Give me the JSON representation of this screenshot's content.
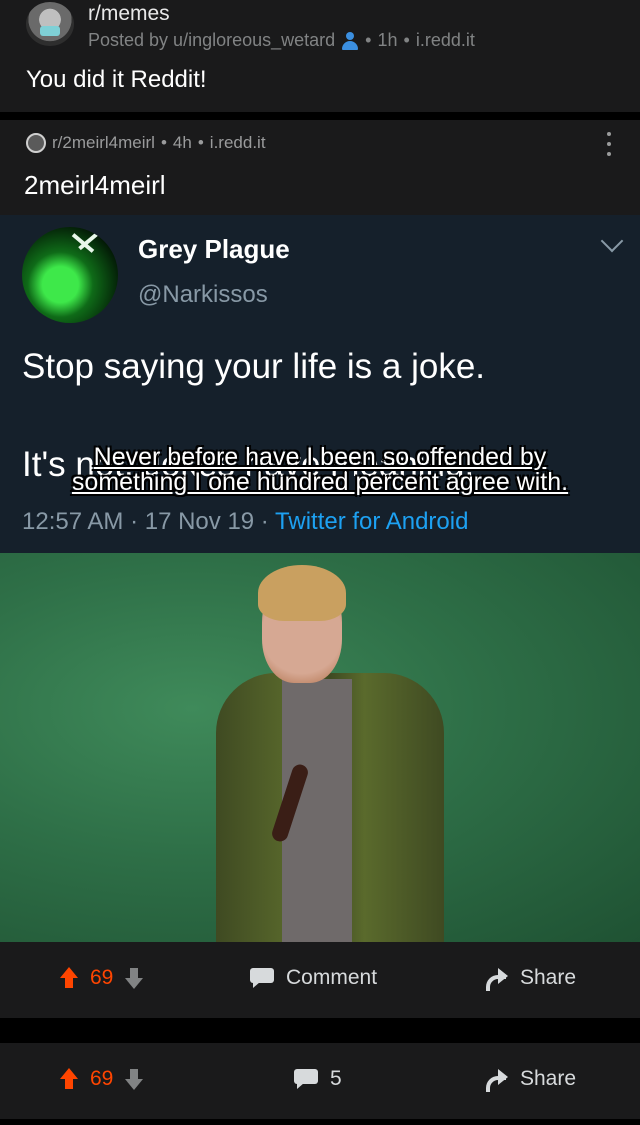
{
  "outer_post": {
    "subreddit": "r/memes",
    "posted_by": "Posted by u/ingloreous_wetard",
    "time": "1h",
    "domain": "i.redd.it",
    "title": "You did it Reddit!"
  },
  "crosspost": {
    "subreddit": "r/2meirl4meirl",
    "time": "4h",
    "domain": "i.redd.it",
    "title": "2meirl4meirl",
    "menu_icon": "more-vertical-icon"
  },
  "tweet": {
    "name": "Grey Plague",
    "handle": "@Narkissos",
    "line1": "Stop saying your life is a joke.",
    "line2": "It's not. Jokes have meaning.",
    "timestamp": "12:57 AM · 17 Nov 19 · ",
    "client": "Twitter for Android"
  },
  "meme_caption": {
    "line1": "Never before have I been so offended by",
    "line2": "something I one hundred percent agree with."
  },
  "action_bars": [
    {
      "score": "69",
      "comment_label": "Comment",
      "share_label": "Share"
    },
    {
      "score": "69",
      "comment_label": "5",
      "share_label": "Share"
    }
  ],
  "colors": {
    "upvote": "#ff4500",
    "background": "#000000",
    "card": "#1a1a1b",
    "tweet_bg": "#15202b",
    "twitter_blue": "#1da1f2"
  }
}
